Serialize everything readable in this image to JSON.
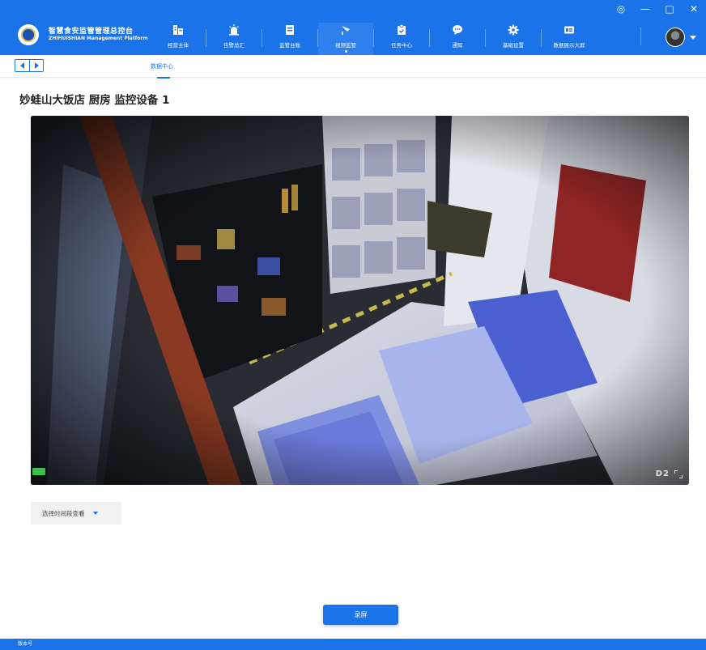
{
  "window_controls": {
    "settings": "◎",
    "minimize": "—",
    "maximize": "□",
    "close": "✕"
  },
  "brand": {
    "title": "智慧食安监管管理总控台",
    "subtitle": "ZHIHUISHIAN Management Platform"
  },
  "nav": {
    "items": [
      {
        "label": "经营主体",
        "icon": "building-icon"
      },
      {
        "label": "告警总汇",
        "icon": "alarm-icon"
      },
      {
        "label": "监管台账",
        "icon": "ledger-icon"
      },
      {
        "label": "视频监管",
        "icon": "video-camera-icon",
        "active": true
      },
      {
        "label": "任务中心",
        "icon": "clipboard-icon"
      },
      {
        "label": "通知",
        "icon": "chat-bubble-icon"
      },
      {
        "label": "基础设置",
        "icon": "gear-icon"
      },
      {
        "label": "数据展示大屏",
        "icon": "screen-icon"
      }
    ]
  },
  "subnav": {
    "tab": "数据中心"
  },
  "page": {
    "title": "妙蛙山大饭店 厨房 监控设备 1"
  },
  "video": {
    "overlay_text": "D2"
  },
  "time_select": {
    "label": "选择时间段查看"
  },
  "record_button": {
    "label": "录屏"
  },
  "footer": {
    "text": "版本号"
  },
  "colors": {
    "primary": "#1a73e8",
    "active_nav": "#2f80ee",
    "live": "#3bbf4a"
  }
}
